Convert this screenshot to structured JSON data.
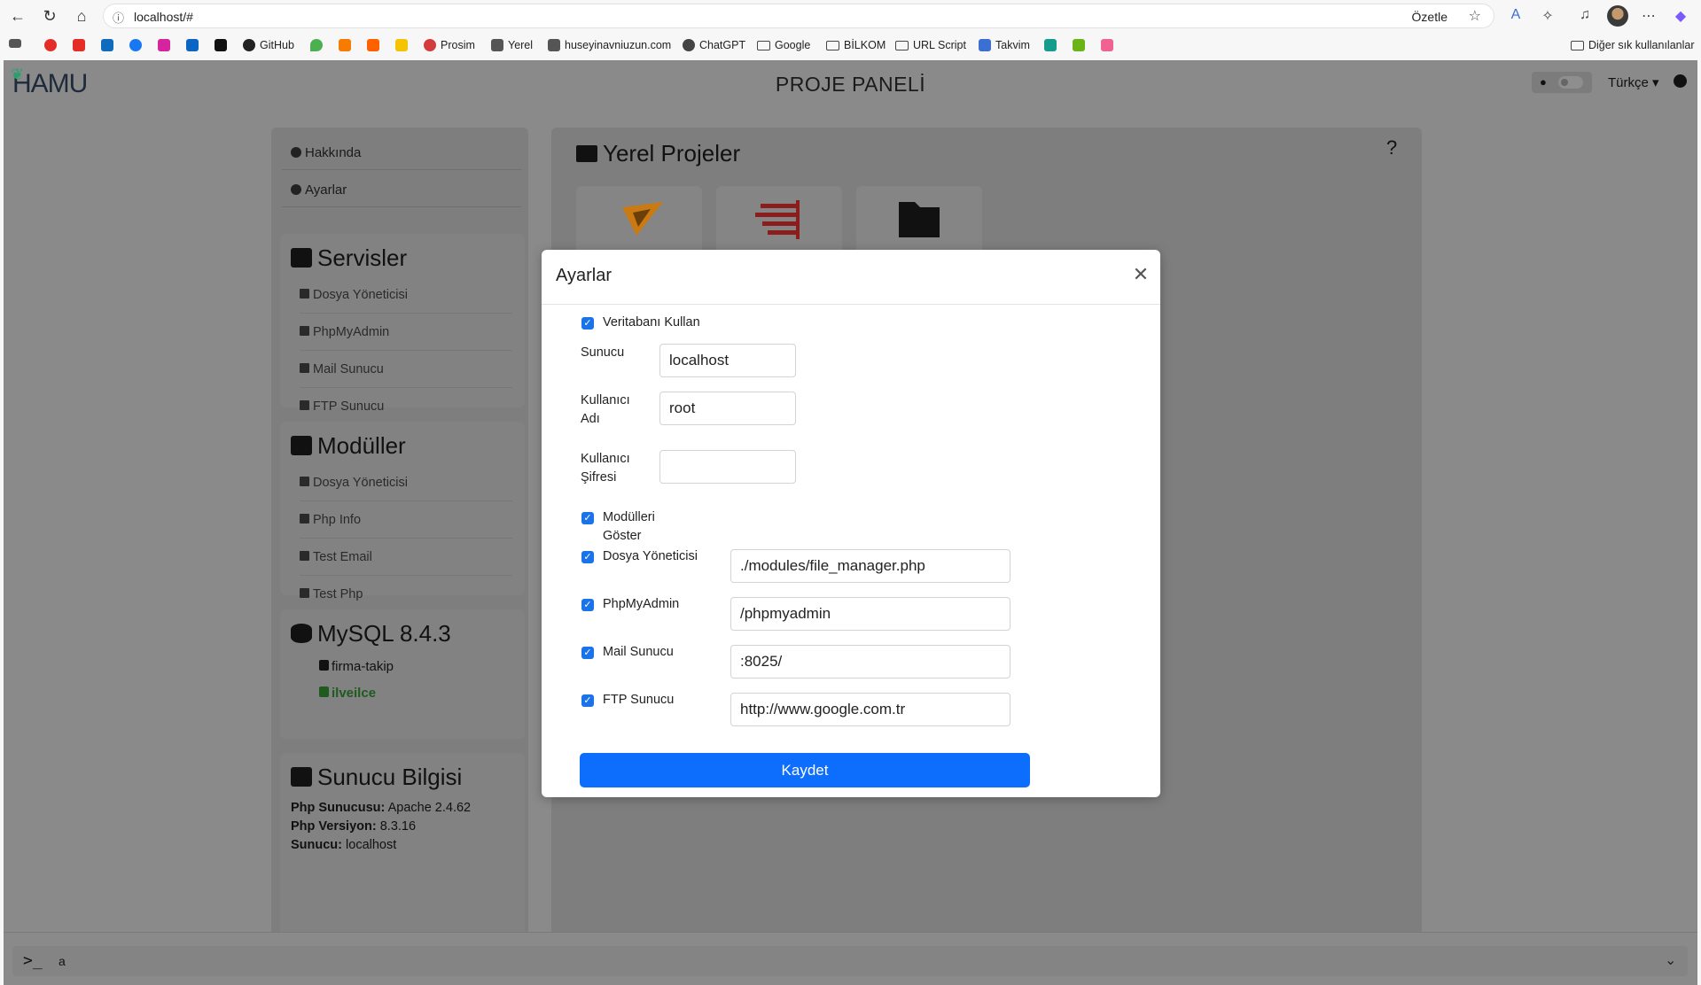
{
  "browser": {
    "url": "localhost/#",
    "summarize_label": "Özetle",
    "bookmarks": [
      {
        "label": "GitHub",
        "color": "#222222"
      },
      {
        "label": "Prosim",
        "color": "#d33c3c"
      },
      {
        "label": "Yerel",
        "color": "#333333"
      },
      {
        "label": "huseyinavniuzun.com",
        "color": "#333333"
      },
      {
        "label": "ChatGPT",
        "color": "#333333"
      },
      {
        "label": "Google",
        "color": "#444444"
      },
      {
        "label": "BİLKOM",
        "color": "#444444"
      },
      {
        "label": "URL Script",
        "color": "#444444"
      },
      {
        "label": "Takvim",
        "color": "#3b6fd1"
      }
    ],
    "other_bookmarks": "Diğer sık kullanılanlar"
  },
  "app": {
    "logo": "HAMU",
    "title": "PROJE PANELİ",
    "language": "Türkçe"
  },
  "sidebar": {
    "about": "Hakkında",
    "settings": "Ayarlar",
    "services": {
      "title": "Servisler",
      "items": [
        "Dosya Yöneticisi",
        "PhpMyAdmin",
        "Mail Sunucu",
        "FTP Sunucu"
      ]
    },
    "modules": {
      "title": "Modüller",
      "items": [
        "Dosya Yöneticisi",
        "Php Info",
        "Test Email",
        "Test Php"
      ]
    },
    "mysql": {
      "title": "MySQL 8.4.3",
      "databases": [
        "firma-takip",
        "ilveilce"
      ]
    },
    "server_info": {
      "title": "Sunucu Bilgisi",
      "php_server_label": "Php Sunucusu:",
      "php_server_value": "Apache 2.4.62",
      "php_version_label": "Php Versiyon:",
      "php_version_value": "8.3.16",
      "host_label": "Sunucu:",
      "host_value": "localhost"
    }
  },
  "main": {
    "title": "Yerel Projeler",
    "help": "?"
  },
  "modal": {
    "title": "Ayarlar",
    "use_db_label": "Veritabanı Kullan",
    "host_label": "Sunucu",
    "host_value": "localhost",
    "user_label": "Kullanıcı Adı",
    "user_value": "root",
    "pass_label": "Kullanıcı Şifresi",
    "pass_value": "",
    "show_modules_label": "Modülleri Göster",
    "file_manager_label": "Dosya Yöneticisi",
    "file_manager_value": "./modules/file_manager.php",
    "phpmyadmin_label": "PhpMyAdmin",
    "phpmyadmin_value": "/phpmyadmin",
    "mail_label": "Mail Sunucu",
    "mail_value": ":8025/",
    "ftp_label": "FTP Sunucu",
    "ftp_value": "http://www.google.com.tr",
    "save_label": "Kaydet"
  },
  "console": {
    "input_value": "a"
  },
  "colors": {
    "primary": "#0d6efd",
    "checkbox": "#1a73e8",
    "active_db": "#1f5a1f",
    "overlay_gray": "#8a8a8a"
  }
}
